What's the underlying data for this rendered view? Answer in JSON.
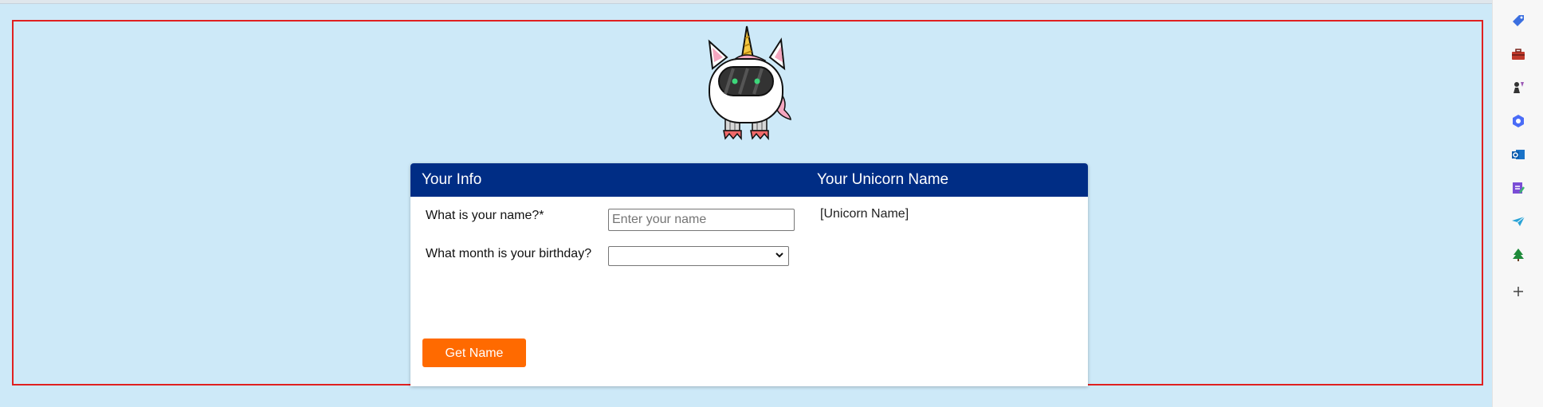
{
  "app": {
    "logo_name": "unicorn-robot-mascot"
  },
  "form": {
    "left_header": "Your Info",
    "right_header": "Your Unicorn Name",
    "name_label": "What is your name?*",
    "name_placeholder": "Enter your name",
    "name_value": "",
    "month_label": "What month is your birthday?",
    "month_value": "",
    "result_text": "[Unicorn Name]",
    "submit_label": "Get Name"
  },
  "colors": {
    "header_bg": "#002d85",
    "button_bg": "#ff6a00",
    "page_bg": "#cde9f8",
    "frame_border": "#e02020"
  },
  "sidebar": {
    "icons": [
      "tag-icon",
      "toolbox-icon",
      "chess-icon",
      "copilot-icon",
      "outlook-icon",
      "notes-icon",
      "send-icon",
      "tree-icon",
      "add-icon"
    ]
  }
}
